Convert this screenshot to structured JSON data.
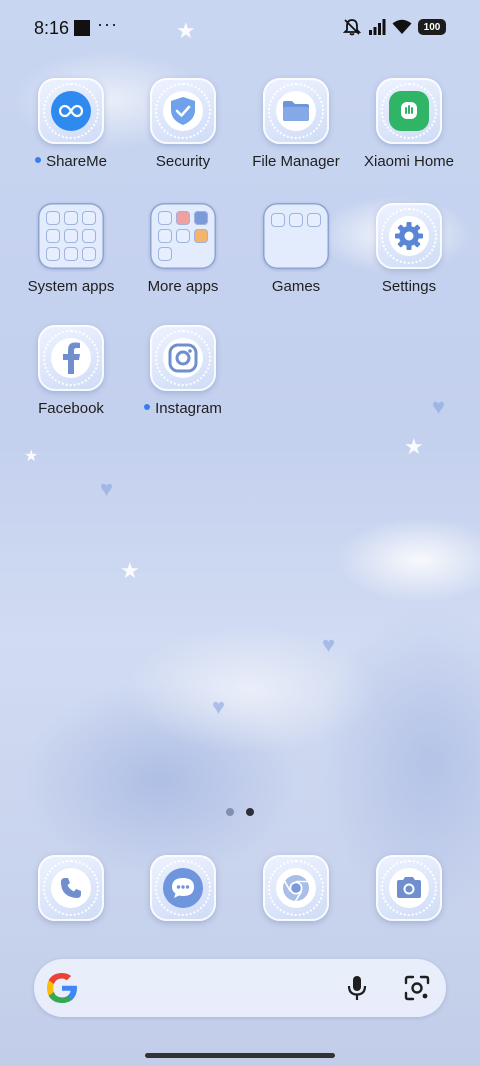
{
  "status_bar": {
    "time": "8:16",
    "more": "···",
    "battery": "100",
    "icons": [
      "notification-square-icon",
      "mute-icon",
      "signal-icon",
      "wifi-icon",
      "battery-icon"
    ]
  },
  "apps": [
    {
      "label": "ShareMe",
      "icon": "shareme-icon",
      "new_dot": true
    },
    {
      "label": "Security",
      "icon": "security-shield-icon",
      "new_dot": false
    },
    {
      "label": "File Manager",
      "icon": "folder-icon",
      "new_dot": false
    },
    {
      "label": "Xiaomi Home",
      "icon": "xiaomi-home-icon",
      "new_dot": false
    },
    {
      "label": "System apps",
      "icon": "folder-grid-icon",
      "new_dot": false
    },
    {
      "label": "More apps",
      "icon": "folder-grid-icon",
      "new_dot": false
    },
    {
      "label": "Games",
      "icon": "folder-grid-icon",
      "new_dot": false
    },
    {
      "label": "Settings",
      "icon": "gear-icon",
      "new_dot": false
    },
    {
      "label": "Facebook",
      "icon": "facebook-icon",
      "new_dot": false
    },
    {
      "label": "Instagram",
      "icon": "instagram-icon",
      "new_dot": true
    }
  ],
  "dock": [
    "phone-icon",
    "messages-icon",
    "chrome-icon",
    "camera-icon"
  ],
  "page_indicator": {
    "pages": 2,
    "active": 2
  },
  "search_bar": {
    "icons": [
      "google-g-icon",
      "microphone-icon",
      "google-lens-icon"
    ]
  },
  "colors": {
    "accent": "#5a8fe0",
    "new_dot": "#3a7bf0",
    "text": "#1f1f1f"
  }
}
